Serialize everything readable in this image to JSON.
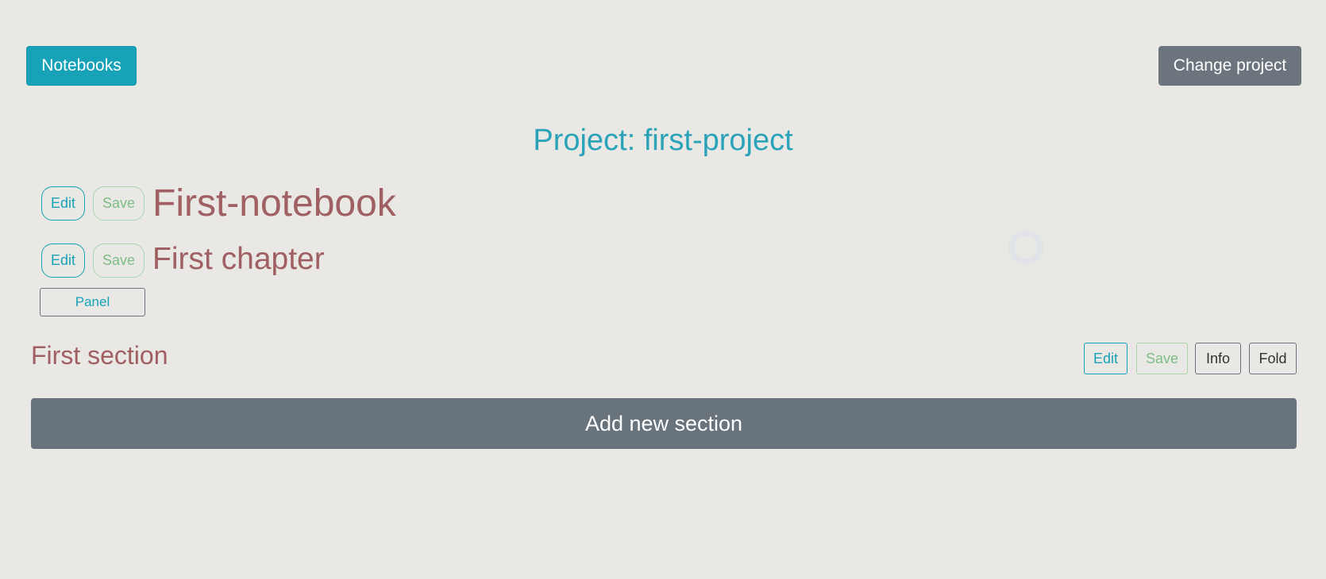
{
  "header": {
    "notebooks_label": "Notebooks",
    "change_project_label": "Change project"
  },
  "project": {
    "title": "Project: first-project"
  },
  "notebook": {
    "edit_label": "Edit",
    "save_label": "Save",
    "title": "First-notebook"
  },
  "chapter": {
    "edit_label": "Edit",
    "save_label": "Save",
    "title": "First chapter",
    "panel_label": "Panel"
  },
  "section": {
    "title": "First section",
    "edit_label": "Edit",
    "save_label": "Save",
    "info_label": "Info",
    "fold_label": "Fold"
  },
  "add_section_label": "Add new section",
  "spinner_icon": "loading-spinner-icon",
  "colors": {
    "accent": "#17a2b8",
    "secondary": "#6c757d",
    "heading": "#a05f62",
    "success_muted": "#7ebd86",
    "background": "#e9e8e4"
  }
}
